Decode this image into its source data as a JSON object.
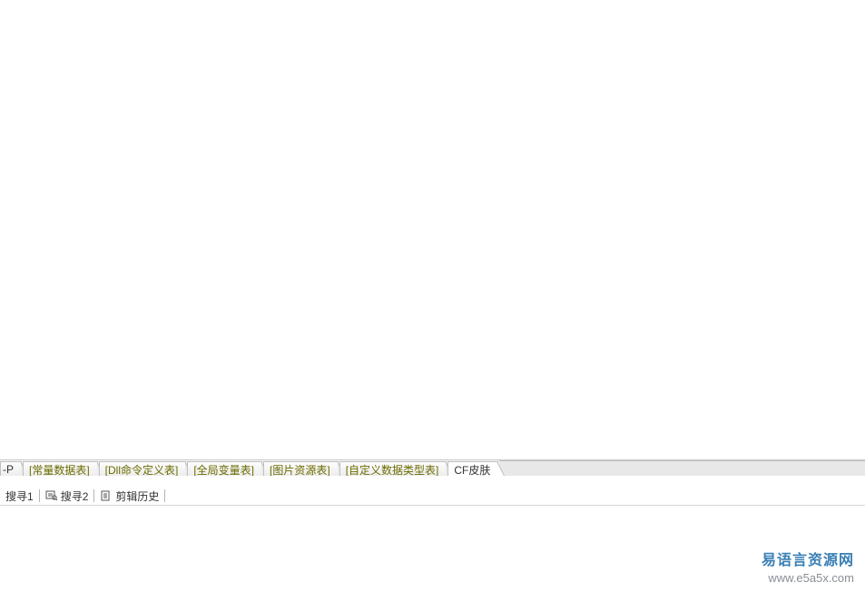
{
  "tabs": {
    "partial_left": "-P",
    "items": [
      {
        "label": "[常量数据表]"
      },
      {
        "label": "[Dll命令定义表]"
      },
      {
        "label": "[全局变量表]"
      },
      {
        "label": "[图片资源表]"
      },
      {
        "label": "[自定义数据类型表]"
      },
      {
        "label": "CF皮肤",
        "plain": true
      }
    ]
  },
  "toolbar": {
    "search1": "搜寻1",
    "search2": "搜寻2",
    "clip_history": "剪辑历史"
  },
  "watermark": {
    "site_name": "易语言资源网",
    "url": "www.e5a5x.com"
  }
}
